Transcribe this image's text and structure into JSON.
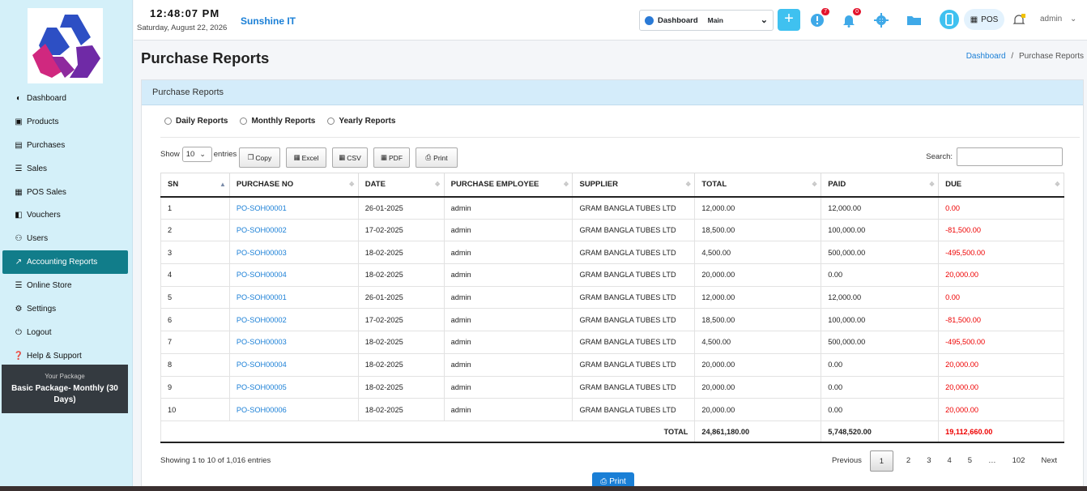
{
  "topbar": {
    "time": "12:48:07 PM",
    "date": "Saturday, August 22, 2026",
    "brand": "Sunshine IT",
    "dashboard_label": "Dashboard",
    "dashboard_value": "Main",
    "alerts_badge": "7",
    "notifications_badge": "0",
    "pos_label": "POS",
    "user": "admin"
  },
  "sidebar": {
    "items": [
      {
        "label": "Dashboard",
        "icon": "dashboard-icon"
      },
      {
        "label": "Products",
        "icon": "box-icon"
      },
      {
        "label": "Purchases",
        "icon": "document-icon"
      },
      {
        "label": "Sales",
        "icon": "cart-icon"
      },
      {
        "label": "POS Sales",
        "icon": "register-icon"
      },
      {
        "label": "Vouchers",
        "icon": "voucher-icon"
      },
      {
        "label": "Users",
        "icon": "users-icon"
      },
      {
        "label": "Accounting Reports",
        "icon": "chart-icon"
      },
      {
        "label": "Online Store",
        "icon": "cart-icon"
      },
      {
        "label": "Settings",
        "icon": "gears-icon"
      },
      {
        "label": "Logout",
        "icon": "logout-icon"
      },
      {
        "label": "Help & Support",
        "icon": "help-icon"
      }
    ],
    "active_index": 7,
    "package_label": "Your Package",
    "package_name": "Basic Package- Monthly (30 Days)"
  },
  "page": {
    "title": "Purchase Reports",
    "breadcrumb_home": "Dashboard",
    "breadcrumb_sep": "/",
    "breadcrumb_current": "Purchase Reports"
  },
  "card": {
    "title": "Purchase Reports",
    "radios": [
      "Daily Reports",
      "Monthly Reports",
      "Yearly Reports"
    ],
    "show_label": "Show",
    "show_value": "10",
    "entries_label": "entries",
    "buttons": [
      "Copy",
      "Excel",
      "CSV",
      "PDF",
      "Print"
    ],
    "search_label": "Search:",
    "search_value": ""
  },
  "table": {
    "columns": [
      "SN",
      "PURCHASE NO",
      "DATE",
      "PURCHASE EMPLOYEE",
      "SUPPLIER",
      "TOTAL",
      "PAID",
      "DUE"
    ],
    "rows": [
      [
        "1",
        "PO-SOH00001",
        "26-01-2025",
        "admin",
        "GRAM BANGLA TUBES LTD",
        "12,000.00",
        "12,000.00",
        "0.00"
      ],
      [
        "2",
        "PO-SOH00002",
        "17-02-2025",
        "admin",
        "GRAM BANGLA TUBES LTD",
        "18,500.00",
        "100,000.00",
        "-81,500.00"
      ],
      [
        "3",
        "PO-SOH00003",
        "18-02-2025",
        "admin",
        "GRAM BANGLA TUBES LTD",
        "4,500.00",
        "500,000.00",
        "-495,500.00"
      ],
      [
        "4",
        "PO-SOH00004",
        "18-02-2025",
        "admin",
        "GRAM BANGLA TUBES LTD",
        "20,000.00",
        "0.00",
        "20,000.00"
      ],
      [
        "5",
        "PO-SOH00001",
        "26-01-2025",
        "admin",
        "GRAM BANGLA TUBES LTD",
        "12,000.00",
        "12,000.00",
        "0.00"
      ],
      [
        "6",
        "PO-SOH00002",
        "17-02-2025",
        "admin",
        "GRAM BANGLA TUBES LTD",
        "18,500.00",
        "100,000.00",
        "-81,500.00"
      ],
      [
        "7",
        "PO-SOH00003",
        "18-02-2025",
        "admin",
        "GRAM BANGLA TUBES LTD",
        "4,500.00",
        "500,000.00",
        "-495,500.00"
      ],
      [
        "8",
        "PO-SOH00004",
        "18-02-2025",
        "admin",
        "GRAM BANGLA TUBES LTD",
        "20,000.00",
        "0.00",
        "20,000.00"
      ],
      [
        "9",
        "PO-SOH00005",
        "18-02-2025",
        "admin",
        "GRAM BANGLA TUBES LTD",
        "20,000.00",
        "0.00",
        "20,000.00"
      ],
      [
        "10",
        "PO-SOH00006",
        "18-02-2025",
        "admin",
        "GRAM BANGLA TUBES LTD",
        "20,000.00",
        "0.00",
        "20,000.00"
      ]
    ],
    "total_label": "TOTAL",
    "total_total": "24,861,180.00",
    "total_paid": "5,748,520.00",
    "total_due": "19,112,660.00"
  },
  "footer": {
    "info": "Showing 1 to 10 of 1,016 entries",
    "pager": [
      "Previous",
      "1",
      "2",
      "3",
      "4",
      "5",
      "…",
      "102",
      "Next"
    ],
    "current_page": "1",
    "print_label": "Print"
  },
  "colors": {
    "sidebar_bg": "#d4f0f9",
    "active_nav": "#117d8a",
    "link": "#1a7fd6",
    "due_red": "#e00000",
    "card_head": "#d4ecfa"
  }
}
